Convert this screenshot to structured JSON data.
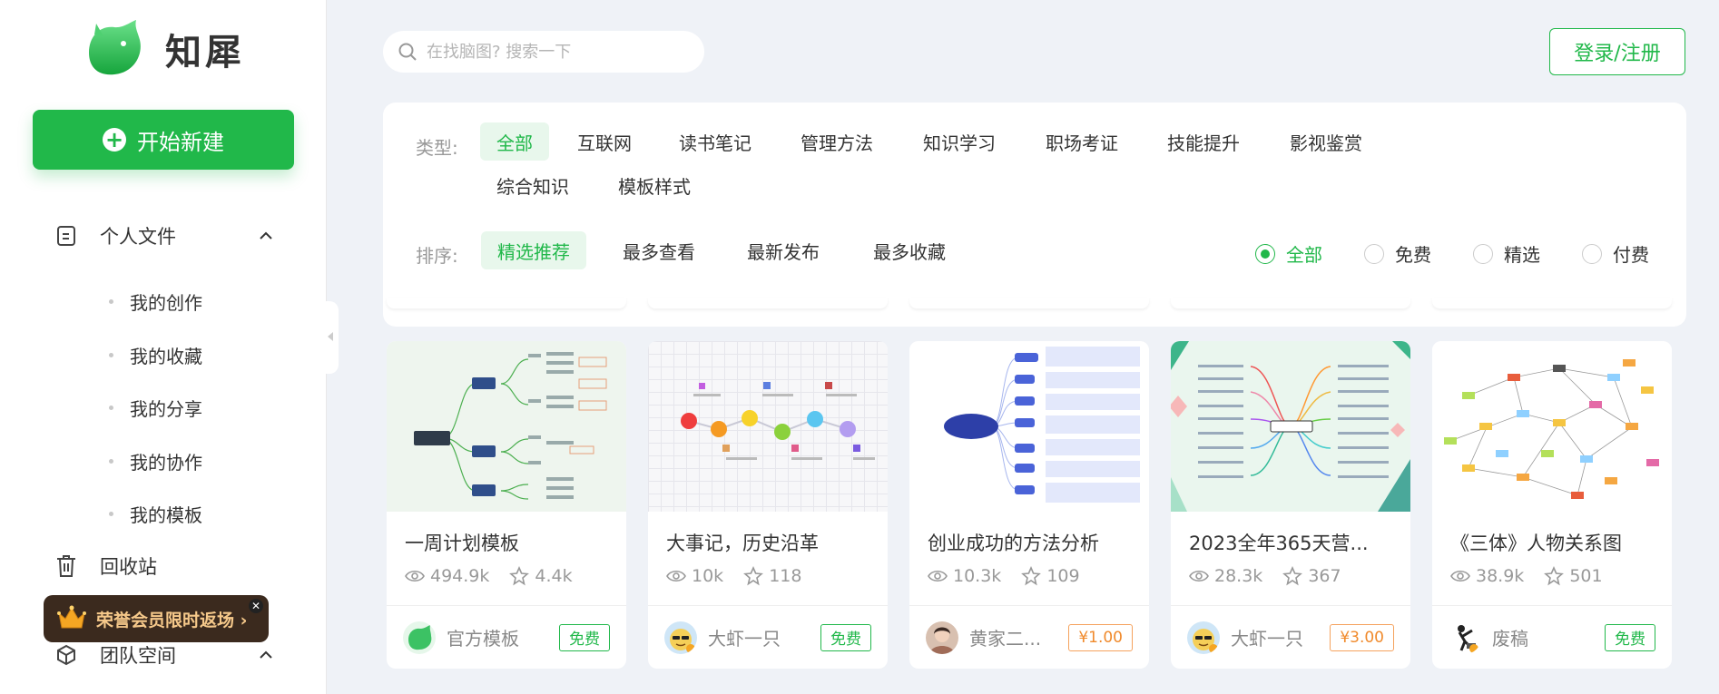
{
  "brand": {
    "name": "知犀",
    "accent": "#21b84a"
  },
  "sidebar": {
    "new_button": "开始新建",
    "personal_files": "个人文件",
    "sub_items": [
      {
        "label": "我的创作"
      },
      {
        "label": "我的收藏"
      },
      {
        "label": "我的分享"
      },
      {
        "label": "我的协作"
      },
      {
        "label": "我的模板"
      }
    ],
    "recycle": "回收站",
    "team_space": "团队空间",
    "vip_banner": "荣誉会员限时返场 ›"
  },
  "search": {
    "placeholder": "在找脑图? 搜索一下"
  },
  "header": {
    "login": "登录/注册"
  },
  "filter": {
    "type_label": "类型:",
    "types": [
      "全部",
      "互联网",
      "读书笔记",
      "管理方法",
      "知识学习",
      "职场考证",
      "技能提升",
      "影视鉴赏",
      "综合知识",
      "模板样式"
    ],
    "active_type": "全部",
    "sort_label": "排序:",
    "sorts": [
      "精选推荐",
      "最多查看",
      "最新发布",
      "最多收藏"
    ],
    "active_sort": "精选推荐",
    "prices": [
      "全部",
      "免费",
      "精选",
      "付费"
    ],
    "active_price": "全部"
  },
  "cards": [
    {
      "title": "一周计划模板",
      "views": "494.9k",
      "stars": "4.4k",
      "author": "官方模板",
      "price": "免费",
      "paid": false,
      "thumb": "tree"
    },
    {
      "title": "大事记，历史沿革",
      "views": "10k",
      "stars": "118",
      "author": "大虾一只",
      "price": "免费",
      "paid": false,
      "thumb": "timeline"
    },
    {
      "title": "创业成功的方法分析",
      "views": "10.3k",
      "stars": "109",
      "author": "黄家二...",
      "price": "¥1.00",
      "paid": true,
      "thumb": "fan"
    },
    {
      "title": "2023全年365天营...",
      "views": "28.3k",
      "stars": "367",
      "author": "大虾一只",
      "price": "¥3.00",
      "paid": true,
      "thumb": "radial"
    },
    {
      "title": "《三体》人物关系图",
      "views": "38.9k",
      "stars": "501",
      "author": "废稿",
      "price": "免费",
      "paid": false,
      "thumb": "network"
    }
  ]
}
